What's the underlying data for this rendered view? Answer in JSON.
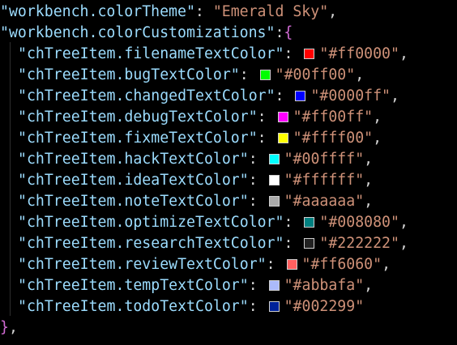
{
  "theme_line": {
    "key": "\"workbench.colorTheme\"",
    "sep": ": ",
    "value": "\"Emerald Sky\"",
    "trail": ","
  },
  "custom_line": {
    "key": "\"workbench.colorCustomizations\"",
    "sep": ":",
    "open_brace": "{"
  },
  "entries": [
    {
      "key": "\"chTreeItem.filenameTextColor\"",
      "sep": ": ",
      "value": "\"#ff0000\"",
      "trail": ",",
      "color": "#ff0000"
    },
    {
      "key": "\"chTreeItem.bugTextColor\"",
      "sep": ": ",
      "value": "\"#00ff00\"",
      "trail": ",",
      "color": "#00ff00"
    },
    {
      "key": "\"chTreeItem.changedTextColor\"",
      "sep": ": ",
      "value": "\"#0000ff\"",
      "trail": ",",
      "color": "#0000ff"
    },
    {
      "key": "\"chTreeItem.debugTextColor\"",
      "sep": ": ",
      "value": "\"#ff00ff\"",
      "trail": ",",
      "color": "#ff00ff"
    },
    {
      "key": "\"chTreeItem.fixmeTextColor\"",
      "sep": ": ",
      "value": "\"#ffff00\"",
      "trail": ",",
      "color": "#ffff00"
    },
    {
      "key": "\"chTreeItem.hackTextColor\"",
      "sep": ": ",
      "value": "\"#00ffff\"",
      "trail": ",",
      "color": "#00ffff"
    },
    {
      "key": "\"chTreeItem.ideaTextColor\"",
      "sep": ": ",
      "value": "\"#ffffff\"",
      "trail": ",",
      "color": "#ffffff"
    },
    {
      "key": "\"chTreeItem.noteTextColor\"",
      "sep": ": ",
      "value": "\"#aaaaaa\"",
      "trail": ",",
      "color": "#aaaaaa"
    },
    {
      "key": "\"chTreeItem.optimizeTextColor\"",
      "sep": ": ",
      "value": "\"#008080\"",
      "trail": ",",
      "color": "#008080"
    },
    {
      "key": "\"chTreeItem.researchTextColor\"",
      "sep": ": ",
      "value": "\"#222222\"",
      "trail": ",",
      "color": "#222222"
    },
    {
      "key": "\"chTreeItem.reviewTextColor\"",
      "sep": ": ",
      "value": "\"#ff6060\"",
      "trail": ",",
      "color": "#ff6060"
    },
    {
      "key": "\"chTreeItem.tempTextColor\"",
      "sep": ": ",
      "value": "\"#abbafa\"",
      "trail": ",",
      "color": "#abbafa"
    },
    {
      "key": "\"chTreeItem.todoTextColor\"",
      "sep": ": ",
      "value": "\"#002299\"",
      "trail": "",
      "color": "#002299"
    }
  ],
  "close_line": {
    "close_brace": "}",
    "trail": ","
  },
  "colors": {
    "background": "#000000",
    "key": "#9cdcfe",
    "string": "#ce9178",
    "brace": "#d16bd4"
  }
}
